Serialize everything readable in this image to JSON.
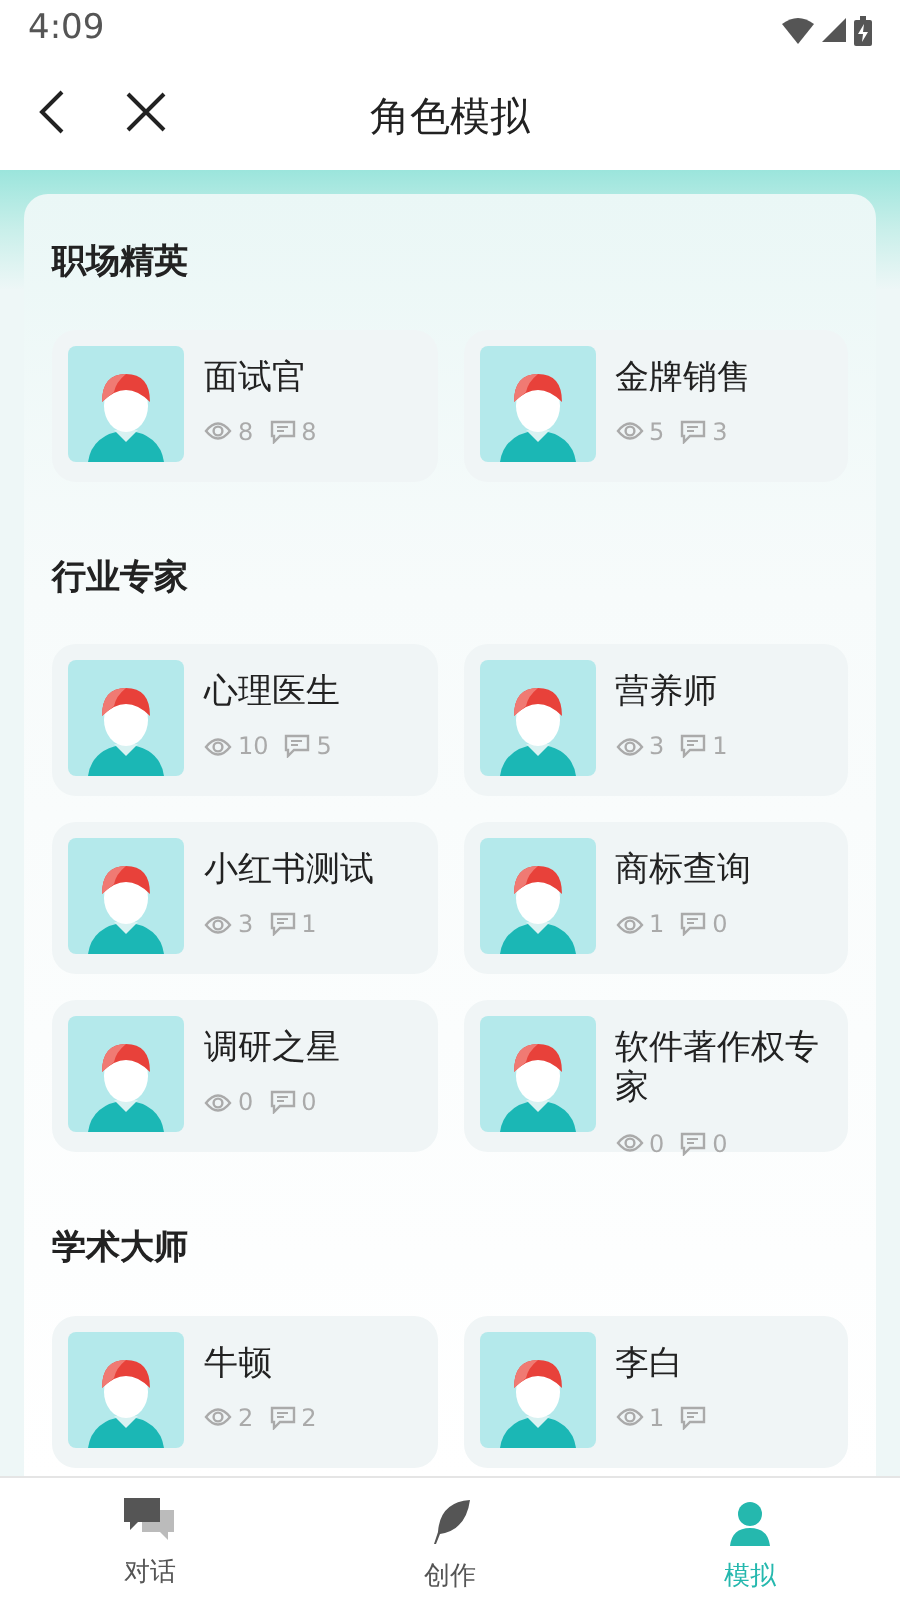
{
  "status_bar": {
    "time": "4:09"
  },
  "header": {
    "title": "角色模拟"
  },
  "sections": [
    {
      "title": "职场精英",
      "roles": [
        {
          "name": "面试官",
          "views": "8",
          "comments": "8"
        },
        {
          "name": "金牌销售",
          "views": "5",
          "comments": "3"
        }
      ]
    },
    {
      "title": "行业专家",
      "roles": [
        {
          "name": "心理医生",
          "views": "10",
          "comments": "5"
        },
        {
          "name": "营养师",
          "views": "3",
          "comments": "1"
        },
        {
          "name": "小红书测试",
          "views": "3",
          "comments": "1"
        },
        {
          "name": "商标查询",
          "views": "1",
          "comments": "0"
        },
        {
          "name": "调研之星",
          "views": "0",
          "comments": "0"
        },
        {
          "name": "软件著作权专家",
          "views": "0",
          "comments": "0"
        }
      ]
    },
    {
      "title": "学术大师",
      "roles": [
        {
          "name": "牛顿",
          "views": "2",
          "comments": "2"
        },
        {
          "name": "李白",
          "views": "1"
        }
      ]
    }
  ],
  "tabs": [
    {
      "label": "对话",
      "kind": "chat",
      "selected": false
    },
    {
      "label": "创作",
      "kind": "feather",
      "selected": false
    },
    {
      "label": "模拟",
      "kind": "role",
      "selected": true
    }
  ]
}
